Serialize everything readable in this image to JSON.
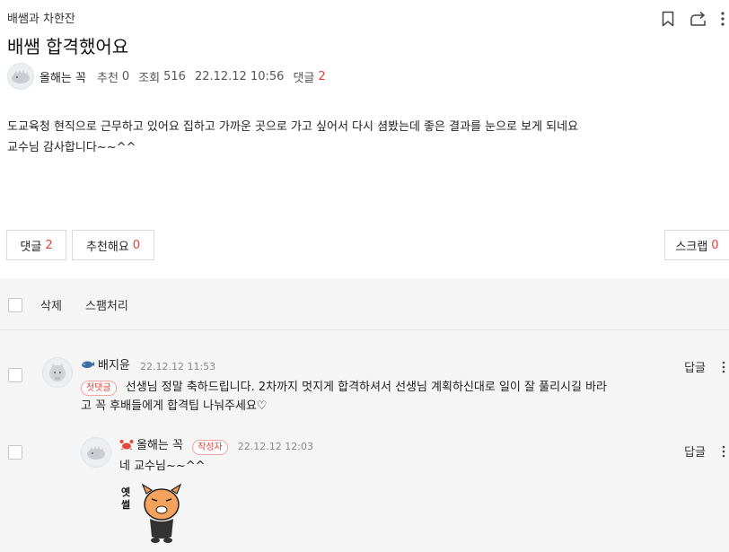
{
  "board": {
    "name": "배쌤과 차한잔"
  },
  "icons": {
    "bookmark": "bookmark-icon",
    "share": "share-icon",
    "more": "more-vertical-icon"
  },
  "post": {
    "title": "배쌤 합격했어요",
    "author": "올해는 꼭",
    "recommend_label": "추천",
    "recommend_count": "0",
    "views_label": "조회",
    "views_count": "516",
    "datetime": "22.12.12 10:56",
    "comments_label": "댓글",
    "comments_count": "2",
    "body_lines": [
      "도교육청 현직으로 근무하고 있어요 집하고 가까운 곳으로 가고 싶어서 다시 셤봤는데 좋은 결과를 눈으로 보게 되네요",
      "교수님 감사합니다~~^^"
    ]
  },
  "actions": {
    "comment_label": "댓글",
    "comment_count": "2",
    "recommend_label": "추천해요",
    "recommend_count": "0",
    "scrap_label": "스크랩",
    "scrap_count": "0"
  },
  "comment_controls": {
    "delete_label": "삭제",
    "spam_label": "스팸처리"
  },
  "comments": [
    {
      "author": "배지윤",
      "time": "22.12.12 11:53",
      "badge": "첫댓글",
      "text_line1": "선생님 정말 축하드립니다. 2차까지 멋지게 합격하셔서 선생님 계획하신대로 일이 잘 풀리시길 바라",
      "text_line2": "고 꼭 후배들에게 합격팁 나눠주세요♡",
      "reply_label": "답글"
    },
    {
      "author": "올해는 꼭",
      "badge": "작성자",
      "time": "22.12.12 12:03",
      "text": "네 교수님~~^^",
      "sticker_text": "옛썰",
      "reply_label": "답글"
    }
  ],
  "colors": {
    "accent_red": "#e4423a",
    "comment_bg": "#f5f5f5",
    "border": "#d9d9d9"
  }
}
